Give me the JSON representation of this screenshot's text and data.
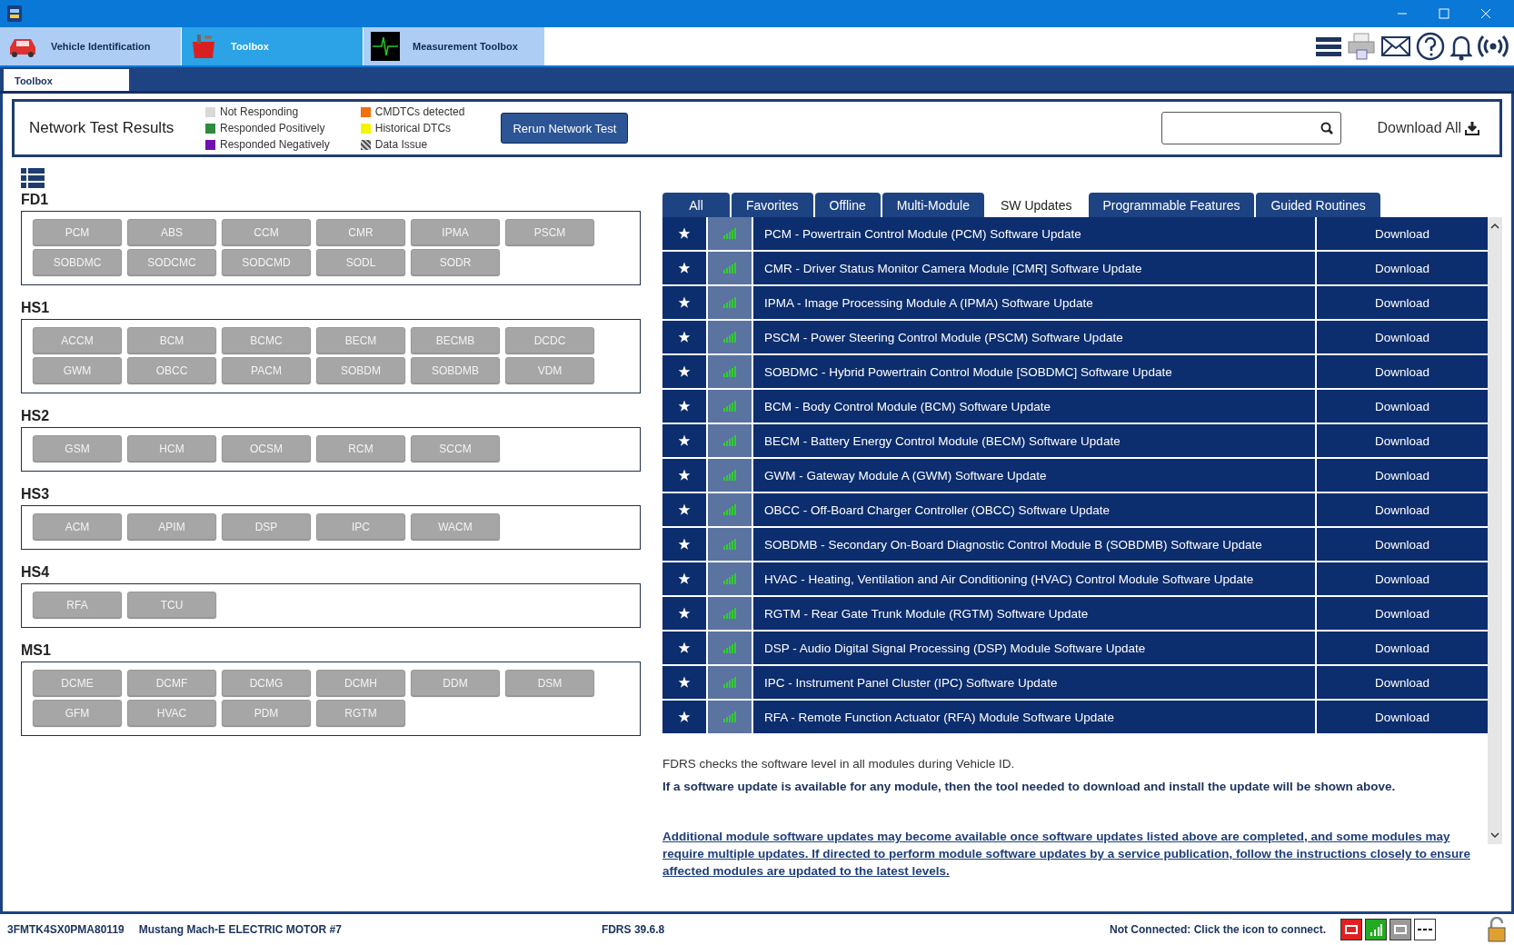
{
  "nav_tabs": [
    {
      "label": "Vehicle Identification",
      "selected": false
    },
    {
      "label": "Toolbox",
      "selected": true
    },
    {
      "label": "Measurement Toolbox",
      "selected": false
    }
  ],
  "sub_tab": "Toolbox",
  "network_test": {
    "title": "Network Test Results",
    "legend": [
      {
        "label": "Not Responding",
        "color": "#d9d9d9",
        "kind": "solid"
      },
      {
        "label": "Responded Positively",
        "color": "#2e8b3e",
        "kind": "solid"
      },
      {
        "label": "Responded Negatively",
        "color": "#7010b0",
        "kind": "solid"
      },
      {
        "label": "CMDTCs detected",
        "color": "#f07010",
        "kind": "solid"
      },
      {
        "label": "Historical DTCs",
        "color": "#f5f500",
        "kind": "solid"
      },
      {
        "label": "Data Issue",
        "color": "#555555",
        "kind": "hatched"
      }
    ],
    "rerun_button": "Rerun Network Test",
    "download_all": "Download All"
  },
  "bus_groups": [
    {
      "name": "FD1",
      "modules": [
        "PCM",
        "ABS",
        "CCM",
        "CMR",
        "IPMA",
        "PSCM",
        "SOBDMC",
        "SODCMC",
        "SODCMD",
        "SODL",
        "SODR"
      ]
    },
    {
      "name": "HS1",
      "modules": [
        "ACCM",
        "BCM",
        "BCMC",
        "BECM",
        "BECMB",
        "DCDC",
        "GWM",
        "OBCC",
        "PACM",
        "SOBDM",
        "SOBDMB",
        "VDM"
      ]
    },
    {
      "name": "HS2",
      "modules": [
        "GSM",
        "HCM",
        "OCSM",
        "RCM",
        "SCCM"
      ]
    },
    {
      "name": "HS3",
      "modules": [
        "ACM",
        "APIM",
        "DSP",
        "IPC",
        "WACM"
      ]
    },
    {
      "name": "HS4",
      "modules": [
        "RFA",
        "TCU"
      ]
    },
    {
      "name": "MS1",
      "modules": [
        "DCME",
        "DCMF",
        "DCMG",
        "DCMH",
        "DDM",
        "DSM",
        "GFM",
        "HVAC",
        "PDM",
        "RGTM"
      ]
    }
  ],
  "filter_tabs": [
    {
      "label": "All",
      "selected": false
    },
    {
      "label": "Favorites",
      "selected": false
    },
    {
      "label": "Offline",
      "selected": false
    },
    {
      "label": "Multi-Module",
      "selected": false
    },
    {
      "label": "SW Updates",
      "selected": true
    },
    {
      "label": "Programmable Features",
      "selected": false
    },
    {
      "label": "Guided Routines",
      "selected": false
    }
  ],
  "updates": [
    {
      "title": "PCM - Powertrain Control Module (PCM) Software Update",
      "action": "Download"
    },
    {
      "title": "CMR - Driver Status Monitor Camera Module [CMR] Software Update",
      "action": "Download"
    },
    {
      "title": "IPMA - Image Processing Module A (IPMA) Software Update",
      "action": "Download"
    },
    {
      "title": "PSCM - Power Steering Control Module (PSCM) Software Update",
      "action": "Download"
    },
    {
      "title": "SOBDMC - Hybrid Powertrain Control Module [SOBDMC] Software Update",
      "action": "Download"
    },
    {
      "title": "BCM - Body Control Module (BCM) Software Update",
      "action": "Download"
    },
    {
      "title": "BECM - Battery Energy Control Module (BECM) Software Update",
      "action": "Download"
    },
    {
      "title": "GWM - Gateway Module A (GWM) Software Update",
      "action": "Download"
    },
    {
      "title": "OBCC - Off-Board Charger Controller (OBCC) Software Update",
      "action": "Download"
    },
    {
      "title": "SOBDMB - Secondary On-Board Diagnostic Control Module B (SOBDMB) Software Update",
      "action": "Download"
    },
    {
      "title": "HVAC - Heating, Ventilation and Air Conditioning (HVAC) Control Module Software Update",
      "action": "Download"
    },
    {
      "title": "RGTM - Rear Gate Trunk Module (RGTM) Software Update",
      "action": "Download"
    },
    {
      "title": "DSP - Audio Digital Signal Processing (DSP) Module Software Update",
      "action": "Download"
    },
    {
      "title": "IPC - Instrument Panel Cluster (IPC) Software Update",
      "action": "Download"
    },
    {
      "title": "RFA - Remote Function Actuator (RFA) Module Software Update",
      "action": "Download"
    }
  ],
  "notes": {
    "info": "FDRS checks the software level in all modules during Vehicle ID.",
    "bold": "If a software update is available for any module, then the tool needed to download and install the update will be shown above.",
    "link": "Additional module software updates may become available once software updates listed above are completed, and some modules may require multiple updates. If directed to perform module software updates by a service publication, follow the instructions closely to ensure affected modules are updated to the latest levels."
  },
  "status_bar": {
    "vin": "3FMTK4SX0PMA80119",
    "vehicle": "Mustang Mach-E ELECTRIC MOTOR #7",
    "version": "FDRS 39.6.8",
    "connection": "Not Connected: Click the icon to connect."
  }
}
